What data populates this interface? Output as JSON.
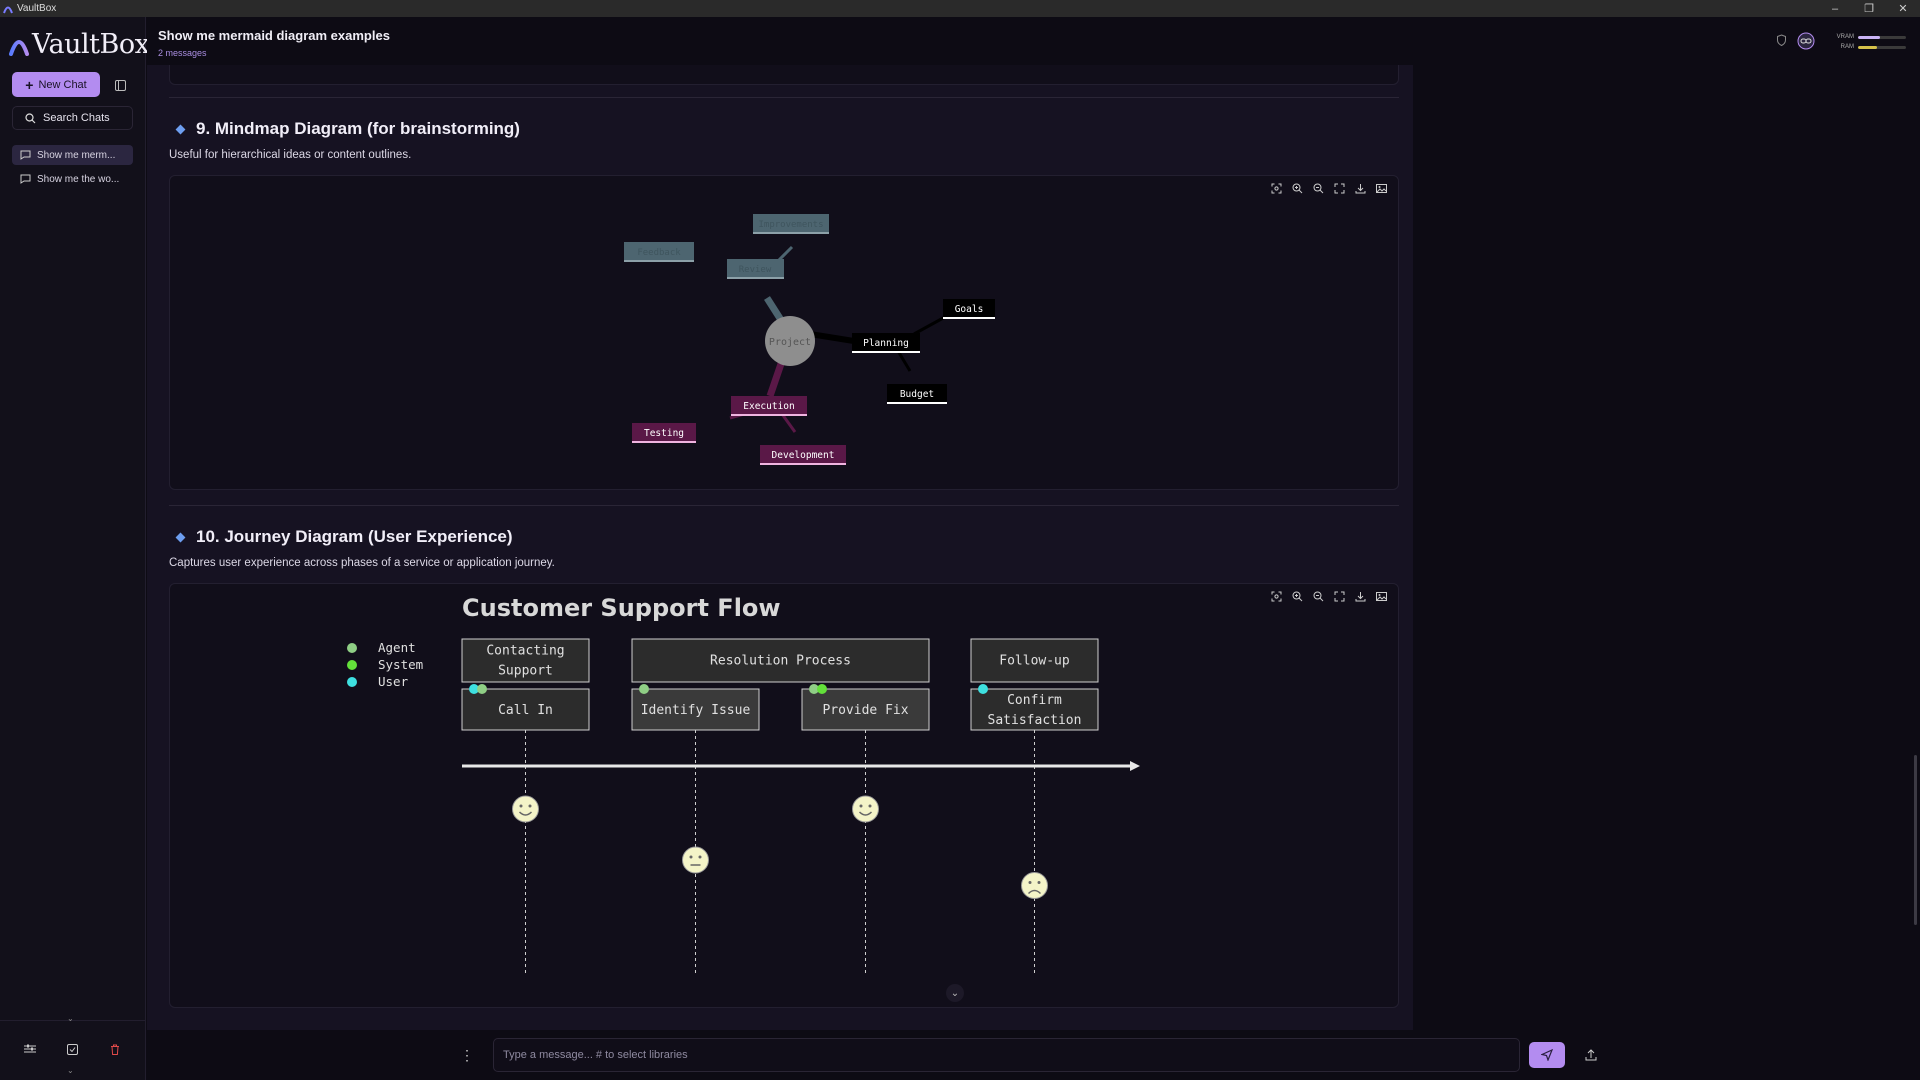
{
  "window": {
    "title": "VaultBox"
  },
  "sidebar": {
    "brand": "VaultBox",
    "new_chat_label": "New Chat",
    "search_label": "Search Chats",
    "chats": [
      {
        "label": "Show me merm...",
        "active": true
      },
      {
        "label": "Show me the wo...",
        "active": false
      }
    ]
  },
  "header": {
    "title": "Show me mermaid diagram examples",
    "subtitle": "2 messages",
    "meters": [
      {
        "label": "VRAM",
        "fraction": 0.45,
        "color": "#c9b3f5"
      },
      {
        "label": "RAM",
        "fraction": 0.4,
        "color": "#d6c24a"
      }
    ]
  },
  "sections": [
    {
      "title": "9. Mindmap Diagram (for brainstorming)",
      "desc": "Useful for hierarchical ideas or content outlines."
    },
    {
      "title": "10. Journey Diagram (User Experience)",
      "desc": "Captures user experience across phases of a service or application journey."
    }
  ],
  "mindmap": {
    "root": "Project",
    "nodes": [
      "Improvements",
      "Feedback",
      "Review",
      "Planning",
      "Goals",
      "Budget",
      "Execution",
      "Testing",
      "Development"
    ]
  },
  "journey": {
    "title": "Customer Support Flow",
    "legend": [
      {
        "label": "Agent",
        "color": "#8fce85"
      },
      {
        "label": "System",
        "color": "#63e03a"
      },
      {
        "label": "User",
        "color": "#3ee0e0"
      }
    ],
    "sections": [
      "Contacting Support",
      "Resolution Process",
      "Follow-up"
    ],
    "section_lines": [
      [
        "Contacting",
        "Support"
      ],
      [
        "Resolution Process"
      ],
      [
        "Follow-up"
      ]
    ],
    "tasks": [
      {
        "lines": [
          "Call In"
        ],
        "score": 5,
        "mood": "happy"
      },
      {
        "lines": [
          "Identify Issue"
        ],
        "score": 3,
        "mood": "neutral"
      },
      {
        "lines": [
          "Provide Fix"
        ],
        "score": 5,
        "mood": "happy"
      },
      {
        "lines": [
          "Confirm",
          "Satisfaction"
        ],
        "score": 2,
        "mood": "sad"
      }
    ]
  },
  "composer": {
    "placeholder": "Type a message... # to select libraries"
  }
}
